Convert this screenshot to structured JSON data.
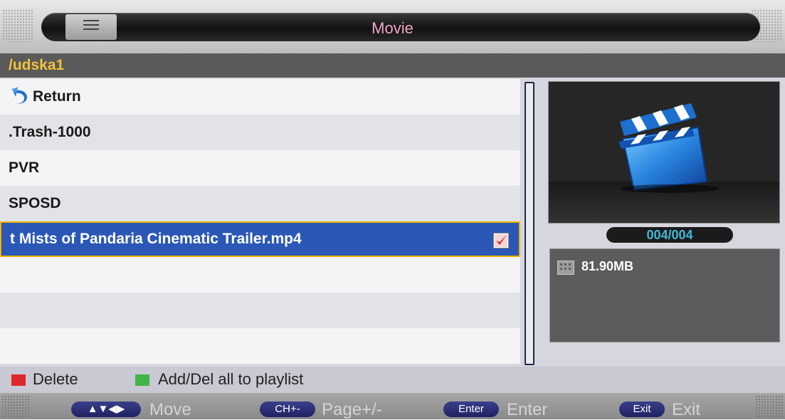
{
  "header": {
    "title": "Movie",
    "menu_icon": "list-icon"
  },
  "path": "/udska1",
  "file_list": [
    {
      "label": "Return",
      "icon": "return-arrow-icon"
    },
    {
      "label": ".Trash-1000"
    },
    {
      "label": "PVR"
    },
    {
      "label": "SPOSD"
    },
    {
      "label": "t Mists of Pandaria Cinematic Trailer.mp4",
      "selected": true,
      "checked": true
    }
  ],
  "preview": {
    "icon": "clapperboard-icon"
  },
  "counter": "004/004",
  "file_info": {
    "size": "81.90MB",
    "icon": "file-info-icon"
  },
  "legend": {
    "delete": {
      "label": "Delete",
      "color": "#e0262d"
    },
    "playlist": {
      "label": "Add/Del all to playlist",
      "color": "#3fb549"
    }
  },
  "footer": {
    "move": {
      "key": "▲▼◀▶",
      "label": "Move"
    },
    "page": {
      "key": "CH+-",
      "label": "Page+/-"
    },
    "enter": {
      "key": "Enter",
      "label": "Enter"
    },
    "exit": {
      "key": "Exit",
      "label": "Exit"
    }
  },
  "colors": {
    "accent_path": "#f2c23a",
    "title": "#f3a5c8",
    "selection": "#2b58b6",
    "counter": "#3fb9d6"
  }
}
